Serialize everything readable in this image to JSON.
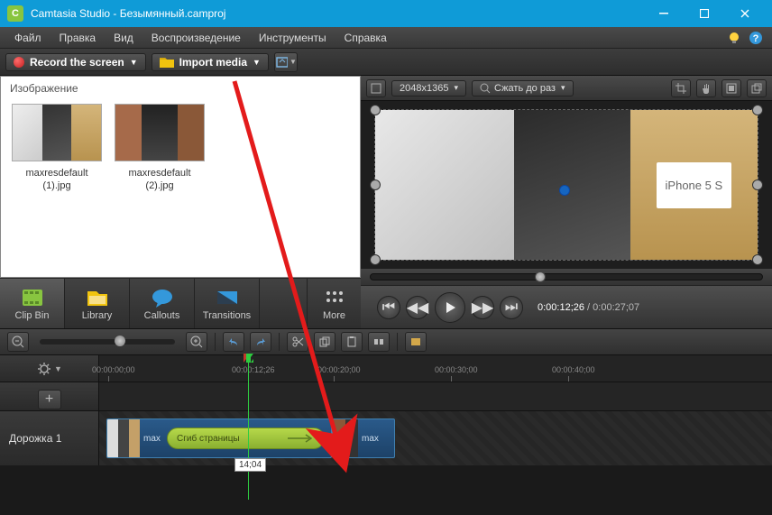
{
  "titlebar": {
    "app": "Camtasia Studio",
    "project": "Безымянный.camproj",
    "separator": " - "
  },
  "menu": {
    "items": [
      "Файл",
      "Правка",
      "Вид",
      "Воспроизведение",
      "Инструменты",
      "Справка"
    ]
  },
  "toolbar": {
    "record": "Record the screen",
    "import": "Import media"
  },
  "clipbin": {
    "header": "Изображение",
    "thumbs": [
      {
        "name": "maxresdefault (1).jpg"
      },
      {
        "name": "maxresdefault (2).jpg"
      }
    ]
  },
  "toolTabs": {
    "clipBin": "Clip Bin",
    "library": "Library",
    "callouts": "Callouts",
    "transitions": "Transitions",
    "more": "More"
  },
  "preview": {
    "dimensions": "2048x1365",
    "shrink": "Сжать до раз",
    "iphoneLabel": "iPhone 5 S",
    "timeCurrent": "0:00:12;26",
    "timeTotal": "0:00:27;07",
    "timeSep": " / "
  },
  "timeline": {
    "ticks": [
      "00:00:00;00",
      "00:00:12;26",
      "00:00:20;00",
      "00:00:30;00",
      "00:00:40;00"
    ],
    "trackName": "Дорожка 1",
    "transitionName": "Сгиб страницы",
    "clip1Label": "max",
    "clip2Label": "max",
    "tooltip": "14;04"
  }
}
